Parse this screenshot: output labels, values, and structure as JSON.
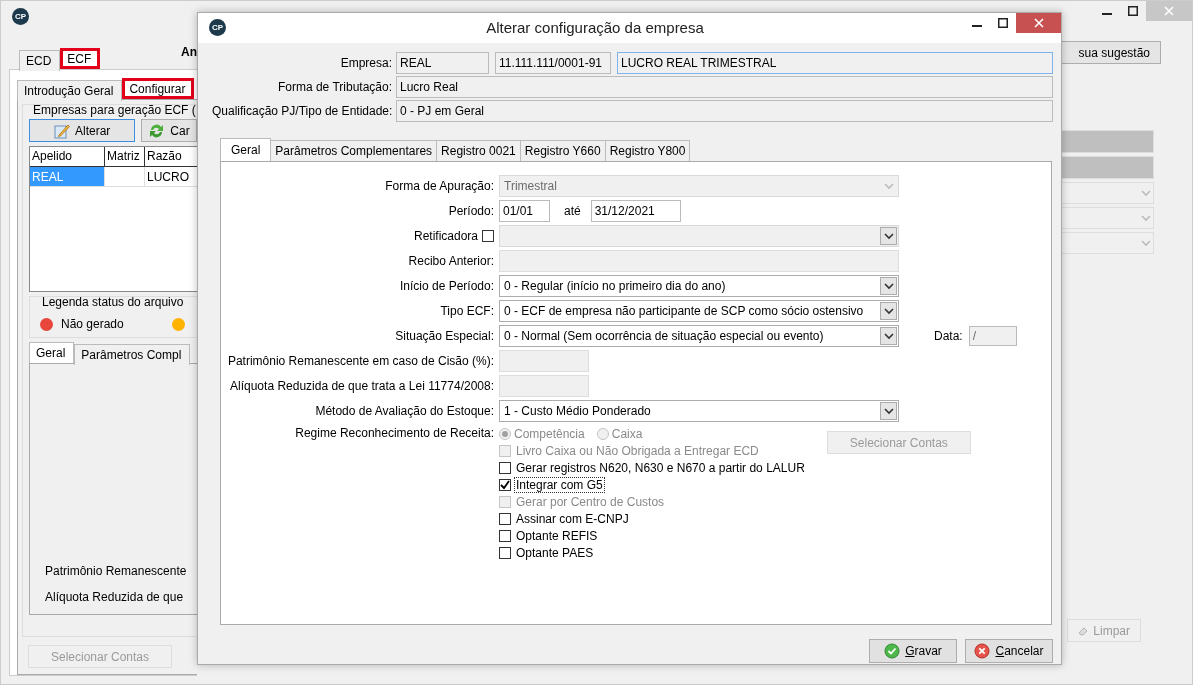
{
  "main_window": {
    "logo": "CP",
    "tabs": [
      {
        "label": "ECD",
        "selected": false,
        "highlighted": false
      },
      {
        "label": "ECF",
        "selected": true,
        "highlighted": true
      }
    ],
    "heading": "An",
    "subtabs": [
      {
        "label": "Introdução Geral",
        "selected": false,
        "highlighted": false
      },
      {
        "label": "Configurar",
        "selected": true,
        "highlighted": true
      }
    ],
    "group_title": "Empresas para geração ECF (",
    "buttons": [
      {
        "label": "Alterar",
        "kind": "edit"
      },
      {
        "label": "Car",
        "kind": "refresh"
      }
    ],
    "table": {
      "columns": [
        "Apelido",
        "Matriz",
        "Razão"
      ],
      "rows": [
        {
          "apelido": "REAL",
          "razao": "LUCRO",
          "selected": true
        }
      ]
    },
    "legend": {
      "title": "Legenda status do arquivo",
      "items": [
        {
          "label": "Não gerado",
          "color": "#e8453c"
        },
        {
          "color": "#ffb300"
        }
      ]
    },
    "lower_tabs": [
      {
        "label": "Geral",
        "selected": true
      },
      {
        "label": "Parâmetros Compl",
        "selected": false
      }
    ],
    "lower_labels": [
      "Patrimônio Remanescente",
      "Alíquota Reduzida de que"
    ],
    "select_accounts_button": {
      "label": "Selecionar Contas",
      "disabled": true
    },
    "suggestion_button": "sua sugestão",
    "clear_button": {
      "label": "Limpar",
      "disabled": true
    }
  },
  "dialog": {
    "logo": "CP",
    "title": "Alterar configuração da empresa",
    "header_fields": [
      {
        "label": "Empresa:",
        "values": [
          "REAL",
          "11.111.111/0001-91",
          "LUCRO REAL TRIMESTRAL"
        ]
      },
      {
        "label": "Forma de Tributação:",
        "values": [
          "Lucro Real"
        ]
      },
      {
        "label": "Qualificação PJ/Tipo de Entidade:",
        "values": [
          "0 - PJ em Geral"
        ]
      }
    ],
    "tabs": [
      {
        "label": "Geral",
        "selected": true
      },
      {
        "label": "Parâmetros Complementares",
        "selected": false
      },
      {
        "label": "Registro 0021",
        "selected": false
      },
      {
        "label": "Registro Y660",
        "selected": false
      },
      {
        "label": "Registro Y800",
        "selected": false
      }
    ],
    "form": [
      {
        "kind": "combo",
        "label": "Forma de Apuração:",
        "value": "Trimestral",
        "disabled": true
      },
      {
        "kind": "period",
        "label": "Período:",
        "from": "01/01",
        "between": "até",
        "to": "31/12/2021"
      },
      {
        "kind": "check_combo",
        "label": "Retificadora",
        "checked": false
      },
      {
        "kind": "text",
        "label": "Recibo Anterior:",
        "disabled": true
      },
      {
        "kind": "combo",
        "label": "Início de Período:",
        "value": "0 - Regular (início no primeiro dia do ano)",
        "disabled": false
      },
      {
        "kind": "combo",
        "label": "Tipo ECF:",
        "value": "0 - ECF de empresa não participante de SCP como sócio ostensivo",
        "disabled": false
      },
      {
        "kind": "combo",
        "label": "Situação Especial:",
        "value": "0 - Normal (Sem ocorrência de situação especial ou evento)",
        "disabled": false,
        "date_label": "Data:",
        "date_value": "/"
      },
      {
        "kind": "small_text",
        "label": "Patrimônio Remanescente em caso de Cisão (%):",
        "disabled": true
      },
      {
        "kind": "small_text",
        "label": "Alíquota Reduzida de que trata a Lei 11774/2008:",
        "disabled": true
      },
      {
        "kind": "combo",
        "label": "Método de Avaliação do Estoque:",
        "value": "1 - Custo Médio Ponderado",
        "disabled": false
      }
    ],
    "regime": {
      "label": "Regime Reconhecimento de Receita:",
      "disabled": true,
      "options": [
        {
          "label": "Competência",
          "selected": true
        },
        {
          "label": "Caixa",
          "selected": false
        }
      ]
    },
    "options": [
      {
        "label": "Livro Caixa ou Não Obrigada a Entregar ECD",
        "checked": false,
        "disabled": true,
        "focused": false
      },
      {
        "label": "Gerar registros N620, N630 e N670 a partir do LALUR",
        "checked": false,
        "disabled": false,
        "focused": false
      },
      {
        "label": "Integrar com G5",
        "checked": true,
        "disabled": false,
        "focused": true
      },
      {
        "label": "Gerar por Centro de Custos",
        "checked": false,
        "disabled": true,
        "focused": false
      },
      {
        "label": "Assinar com E-CNPJ",
        "checked": false,
        "disabled": false,
        "focused": false
      },
      {
        "label": "Optante REFIS",
        "checked": false,
        "disabled": false,
        "focused": false
      },
      {
        "label": "Optante PAES",
        "checked": false,
        "disabled": false,
        "focused": false
      }
    ],
    "select_accounts_button": {
      "label": "Selecionar Contas",
      "disabled": true
    },
    "footer_buttons": [
      {
        "label": "Gravar",
        "kind": "save"
      },
      {
        "label": "Cancelar",
        "kind": "cancel"
      }
    ]
  }
}
